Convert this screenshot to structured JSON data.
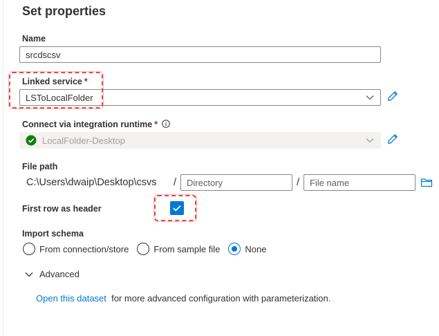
{
  "header": {
    "title": "Set properties"
  },
  "name": {
    "label": "Name",
    "value": "srcdscsv"
  },
  "linked_service": {
    "label": "Linked service",
    "required": "*",
    "value": "LSToLocalFolder"
  },
  "runtime": {
    "label": "Connect via integration runtime",
    "required": "*",
    "value": "LocalFolder-Desktop"
  },
  "file_path": {
    "label": "File path",
    "root": "C:\\Users\\dwaip\\Desktop\\csvs",
    "separator": "/",
    "directory_placeholder": "Directory",
    "filename_placeholder": "File name"
  },
  "first_row": {
    "label": "First row as header",
    "checked": true
  },
  "import_schema": {
    "label": "Import schema",
    "options": [
      "From connection/store",
      "From sample file",
      "None"
    ],
    "selected": "None"
  },
  "advanced": {
    "label": "Advanced"
  },
  "footer": {
    "link": "Open this dataset",
    "text": "for more advanced configuration with parameterization."
  },
  "colors": {
    "accent": "#0078d4",
    "success": "#107c10",
    "highlight": "#e8474d",
    "required": "#a4262c"
  },
  "icons": [
    "pencil-icon",
    "chevron-down-icon",
    "info-icon",
    "check-circle-icon",
    "folder-icon",
    "checkmark-icon",
    "chevron-down-icon"
  ]
}
